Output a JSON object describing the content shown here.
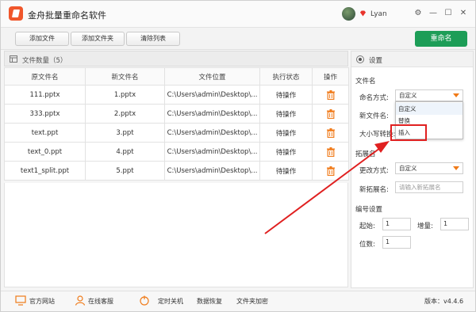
{
  "app": {
    "title": "金舟批量重命名软件",
    "user": "Lyan"
  },
  "window_controls": {
    "settings": "⚙",
    "minimize": "—",
    "maximize": "☐",
    "close": "✕"
  },
  "toolbar": {
    "add_file": "添加文件",
    "add_folder": "添加文件夹",
    "clear_list": "清除列表",
    "rename": "重命名"
  },
  "files": {
    "count_label": "文件数量（5）",
    "columns": [
      "原文件名",
      "新文件名",
      "文件位置",
      "执行状态",
      "操作"
    ],
    "rows": [
      {
        "original": "111.pptx",
        "new": "1.pptx",
        "location": "C:\\Users\\admin\\Desktop\\...",
        "status": "待操作"
      },
      {
        "original": "333.pptx",
        "new": "2.pptx",
        "location": "C:\\Users\\admin\\Desktop\\...",
        "status": "待操作"
      },
      {
        "original": "text.ppt",
        "new": "3.ppt",
        "location": "C:\\Users\\admin\\Desktop\\...",
        "status": "待操作"
      },
      {
        "original": "text_0.ppt",
        "new": "4.ppt",
        "location": "C:\\Users\\admin\\Desktop\\...",
        "status": "待操作"
      },
      {
        "original": "text1_split.ppt",
        "new": "5.ppt",
        "location": "C:\\Users\\admin\\Desktop\\...",
        "status": "待操作"
      }
    ]
  },
  "settings": {
    "header": "设置",
    "filename_section": "文件名",
    "naming_mode_label": "命名方式:",
    "naming_mode_value": "自定义",
    "new_filename_label": "新文件名:",
    "case_convert_label": "大小写转换:",
    "dropdown_options": [
      "自定义",
      "替换",
      "插入"
    ],
    "extension_section": "拓展名",
    "change_mode_label": "更改方式:",
    "change_mode_value": "自定义",
    "new_extension_label": "新拓展名:",
    "new_extension_placeholder": "请输入新拓展名",
    "numbering_section": "编号设置",
    "start_label": "起始:",
    "start_value": "1",
    "increment_label": "增量:",
    "increment_value": "1",
    "digits_label": "位数:",
    "digits_value": "1"
  },
  "statusbar": {
    "website": "官方网站",
    "support": "在线客服",
    "shutdown": "定时关机",
    "recovery": "数据恢复",
    "folder_encrypt": "文件夹加密",
    "version": "版本：v4.4.6"
  },
  "colors": {
    "accent_green": "#1d9d57",
    "highlight_red": "#e02020",
    "icon_orange": "#f07a18",
    "logo": "#f0562b"
  }
}
